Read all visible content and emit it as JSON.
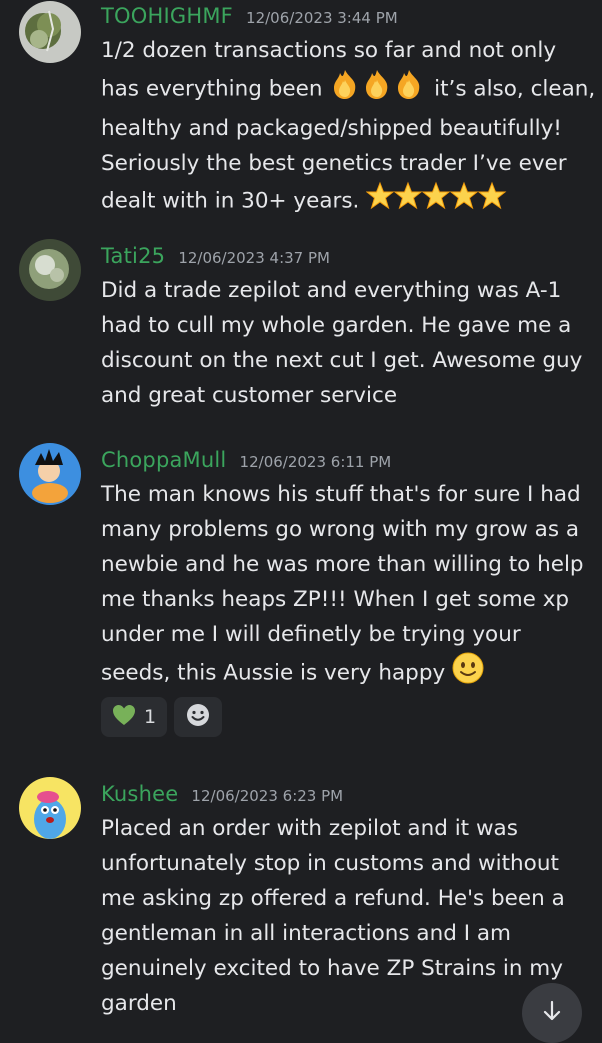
{
  "messages": [
    {
      "username": "TOOHIGHMF",
      "timestamp": "12/06/2023 3:44 PM",
      "lines": [
        "1/2 dozen transactions so far and not only",
        "has everything been",
        "it’s also, clean,",
        "healthy and packaged/shipped beautifully!",
        "Seriously the best genetics trader I’ve ever",
        "dealt with in 30+ years."
      ]
    },
    {
      "username": "Tati25",
      "timestamp": "12/06/2023 4:37 PM",
      "lines": [
        "Did a trade zepilot and everything was A-1",
        "had to cull my whole garden. He gave me a",
        "discount on the next cut I get. Awesome guy",
        "and great customer service"
      ]
    },
    {
      "username": "ChoppaMull",
      "timestamp": "12/06/2023 6:11 PM",
      "lines": [
        "The man knows his stuff that's for sure I had",
        "many problems go wrong with my grow as a",
        "newbie and he was more than willing to help",
        "me thanks heaps ZP!!! When I get some xp",
        "under me I will definetly be trying your",
        "seeds, this Aussie is very happy"
      ],
      "reactions": [
        {
          "icon": "green-heart-icon",
          "count": "1"
        },
        {
          "icon": "add-reaction-icon"
        }
      ]
    },
    {
      "username": "Kushee",
      "timestamp": "12/06/2023 6:23 PM",
      "lines": [
        "Placed an order with zepilot and it was",
        "unfortunately stop in customs and without",
        "me asking zp offered a refund. He's been a",
        "gentleman in all interactions and I am",
        "genuinely excited to have ZP Strains in my",
        "garden"
      ]
    }
  ],
  "colors": {
    "background": "#1e1f22",
    "username": "#3ba55d",
    "timestamp": "#9ea3aa",
    "text": "#e6e7ea",
    "reaction_bg": "#2b2d31"
  },
  "icons": {
    "fire": "fire-emoji-icon",
    "star": "star-emoji-icon",
    "smile": "slightly-smiling-face-icon",
    "scroll": "arrow-down-icon"
  }
}
